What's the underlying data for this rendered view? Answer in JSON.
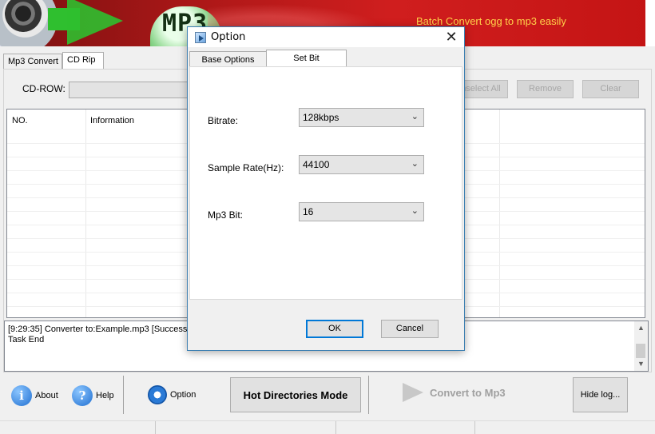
{
  "banner": {
    "logo_text": "MP3",
    "tagline": "Batch Convert  ogg to mp3 easily"
  },
  "main_tabs": [
    {
      "label": "Mp3 Convert"
    },
    {
      "label": "CD Rip"
    }
  ],
  "cd_rip": {
    "cd_row_label": "CD-ROW:",
    "buttons": {
      "unselect_all": "Unselect All",
      "remove": "Remove",
      "clear": "Clear"
    }
  },
  "list": {
    "columns": [
      "NO.",
      "Information"
    ]
  },
  "log": {
    "lines": [
      "[9:29:35] Converter to:Example.mp3 [Success]",
      "Task End"
    ]
  },
  "toolbar": {
    "about": "About",
    "help": "Help",
    "option": "Option",
    "hot_dir_mode": "Hot Directories Mode",
    "convert": "Convert to Mp3",
    "hide_log": "Hide log..."
  },
  "dialog": {
    "title": "Option",
    "tabs": [
      "Base Options",
      "Set Bit"
    ],
    "active_tab": "Set Bit",
    "fields": {
      "bitrate": {
        "label": "Bitrate:",
        "value": "128kbps"
      },
      "sample_rate": {
        "label": "Sample Rate(Hz):",
        "value": "44100"
      },
      "mp3_bit": {
        "label": "Mp3 Bit:",
        "value": "16"
      }
    },
    "ok_label": "OK",
    "cancel_label": "Cancel"
  },
  "colors": {
    "banner_red": "#c41414",
    "tagline": "#ffd24a",
    "dialog_border": "#3c7fb1",
    "ok_focus": "#0078d7"
  },
  "icons": {
    "about": "info-icon",
    "help": "question-icon",
    "option": "gear-icon",
    "convert": "play-arrow-icon"
  }
}
